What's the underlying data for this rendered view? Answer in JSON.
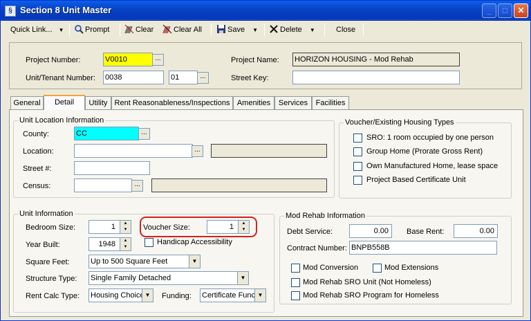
{
  "window": {
    "title": "Section 8 Unit Master",
    "icon": "app-icon"
  },
  "titlebar_buttons": {
    "minimize": "_",
    "maximize": "□",
    "close": "✕"
  },
  "toolbar": {
    "quick_link": "Quick Link...",
    "prompt": "Prompt",
    "clear": "Clear",
    "clear_all": "Clear All",
    "save": "Save",
    "delete": "Delete",
    "close": "Close"
  },
  "header": {
    "project_number_label": "Project Number:",
    "project_number": "V0010",
    "unit_tenant_label": "Unit/Tenant Number:",
    "unit_number": "0038",
    "tenant_suffix": "01",
    "project_name_label": "Project Name:",
    "project_name": "HORIZON HOUSING - Mod Rehab",
    "street_key_label": "Street Key:",
    "street_key": ""
  },
  "tabs": [
    "General",
    "Detail",
    "Utility",
    "Rent Reasonableness/Inspections",
    "Amenities",
    "Services",
    "Facilities"
  ],
  "active_tab": "Detail",
  "unit_location": {
    "title": "Unit Location Information",
    "county_label": "County:",
    "county": "CC",
    "location_label": "Location:",
    "location": "",
    "street_label": "Street #:",
    "street": "",
    "census_label": "Census:",
    "census": ""
  },
  "voucher_types": {
    "title": "Voucher/Existing Housing Types",
    "items": [
      "SRO: 1 room occupied by one person",
      "Group Home (Prorate Gross Rent)",
      "Own Manufactured Home, lease space",
      "Project Based Certificate Unit"
    ]
  },
  "unit_info": {
    "title": "Unit Information",
    "bedroom_label": "Bedroom Size:",
    "bedroom": "1",
    "voucher_label": "Voucher Size:",
    "voucher": "1",
    "year_label": "Year Built:",
    "year": "1948",
    "handicap_label": "Handicap Accessibility",
    "sqft_label": "Square Feet:",
    "sqft": "Up to 500 Square Feet",
    "structure_label": "Structure Type:",
    "structure": "Single Family Detached",
    "rent_calc_label": "Rent Calc Type:",
    "rent_calc": "Housing Choice",
    "funding_label": "Funding:",
    "funding": "Certificate Func"
  },
  "mod_rehab": {
    "title": "Mod Rehab Information",
    "debt_label": "Debt Service:",
    "debt": "0.00",
    "base_rent_label": "Base Rent:",
    "base_rent": "0.00",
    "contract_label": "Contract Number:",
    "contract": "BNPB558B",
    "checks": [
      "Mod Conversion",
      "Mod Extensions",
      "Mod Rehab SRO Unit (Not Homeless)",
      "Mod Rehab SRO Program for Homeless"
    ]
  },
  "colors": {
    "highlight_yellow": "#ffff00",
    "highlight_cyan": "#00ffff",
    "annotation_red": "#d42020"
  }
}
